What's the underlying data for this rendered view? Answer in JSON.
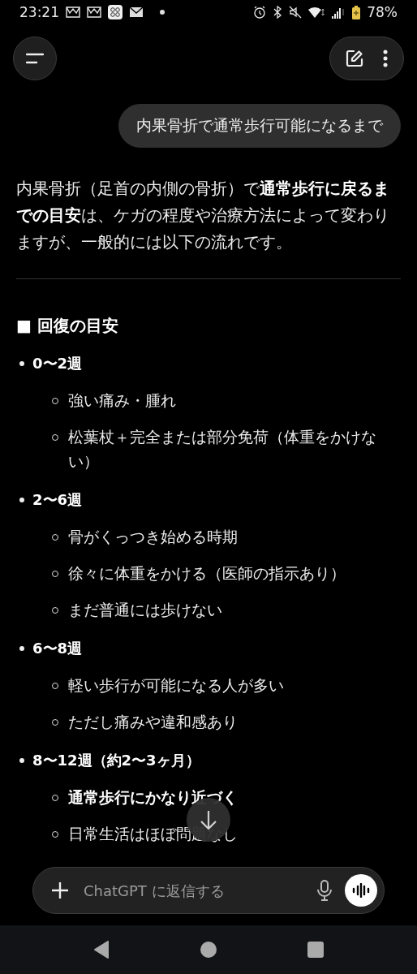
{
  "status_bar": {
    "time": "23:21",
    "battery": "78%"
  },
  "user_message": "内果骨折で通常歩行可能になるまで",
  "reply": {
    "intro": "内果骨折（足首の内側の骨折）で**通常歩行に戻るまでの目安**は、ケガの程度や治療方法によって変わりますが、一般的には以下の流れです。",
    "heading": "■ 回復の目安",
    "sections": [
      {
        "label": "0〜2週",
        "items": [
          {
            "text": "強い痛み・腫れ",
            "emphasis": false
          },
          {
            "text": "松葉杖＋完全または部分免荷（体重をかけない）",
            "emphasis": false
          }
        ]
      },
      {
        "label": "2〜6週",
        "items": [
          {
            "text": "骨がくっつき始める時期",
            "emphasis": false
          },
          {
            "text": "徐々に体重をかける（医師の指示あり）",
            "emphasis": false
          },
          {
            "text": "まだ普通には歩けない",
            "emphasis": false
          }
        ]
      },
      {
        "label": "6〜8週",
        "items": [
          {
            "text": "軽い歩行が可能になる人が多い",
            "emphasis": false
          },
          {
            "text": "ただし痛みや違和感あり",
            "emphasis": false
          }
        ]
      },
      {
        "label": "8〜12週（約2〜3ヶ月）",
        "items": [
          {
            "text": "通常歩行にかなり近づく",
            "emphasis": true
          },
          {
            "text": "日常生活はほぼ問題なし",
            "emphasis": false
          }
        ]
      }
    ]
  },
  "composer": {
    "placeholder": "ChatGPT に返信する"
  }
}
